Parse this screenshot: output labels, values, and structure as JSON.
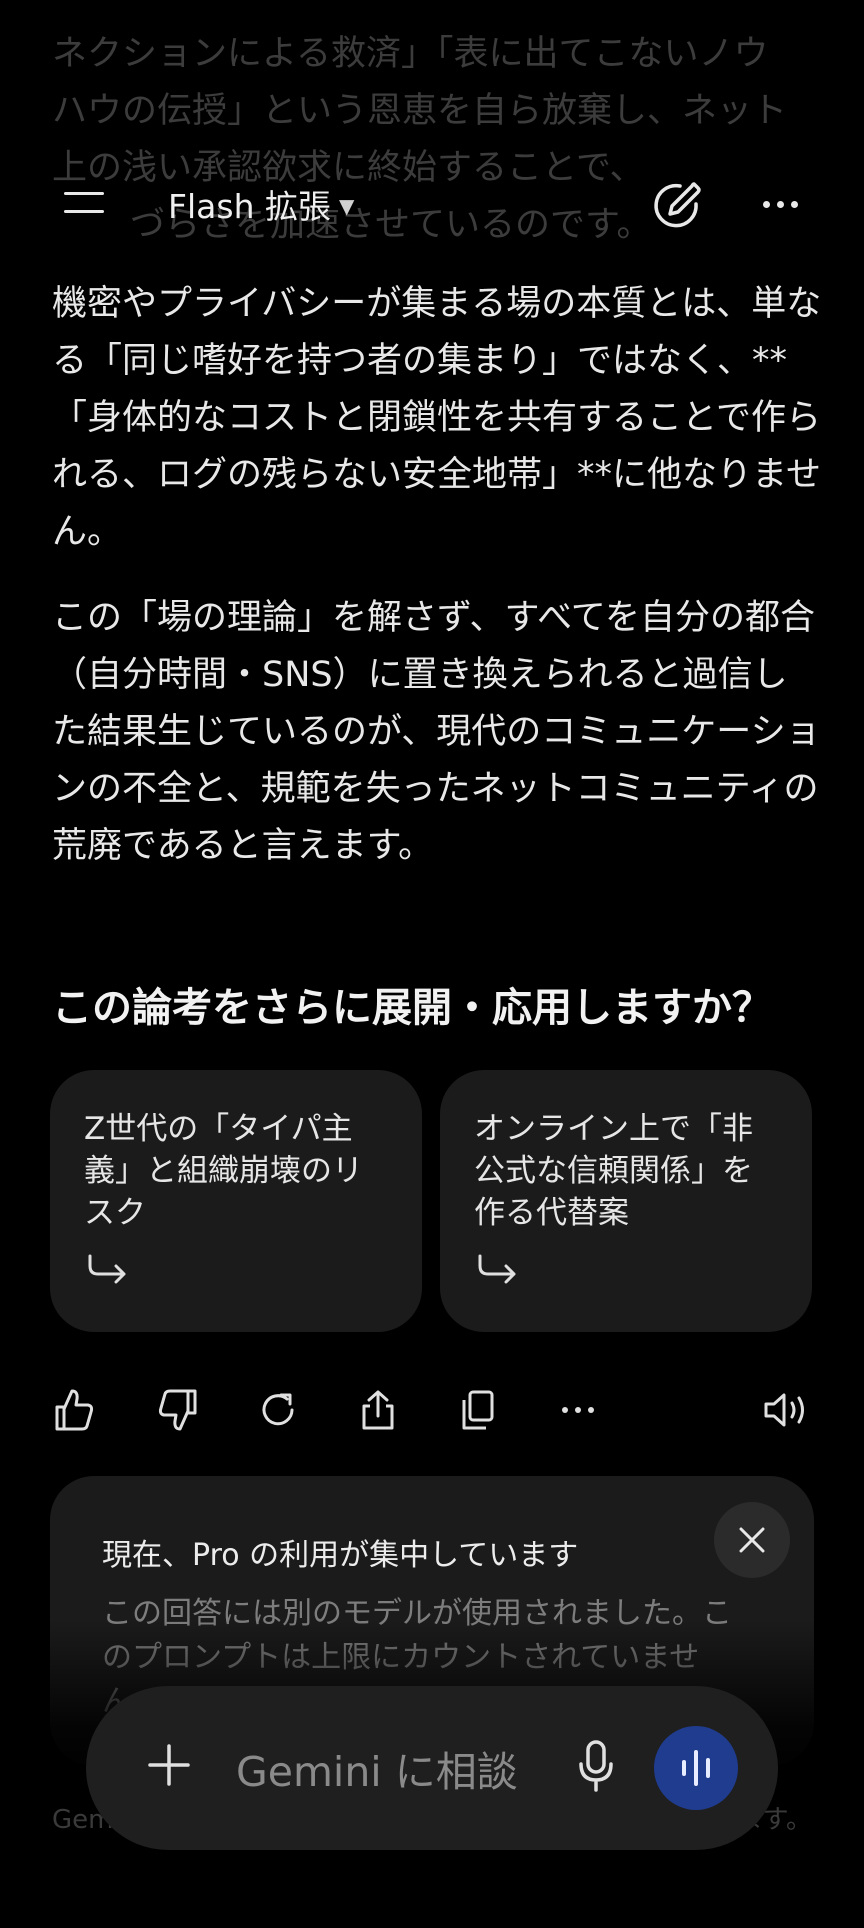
{
  "header": {
    "model_label": "Flash 拡張"
  },
  "content": {
    "faded_lines": [
      "ネクションによる救済」「表に出てこないノウ",
      "ハウの伝授」という恩恵を自ら放棄し、ネット",
      "上の浅い承認欲求に終始することで、",
      "づらさを加速させているのです。"
    ],
    "paragraph1": "機密やプライバシーが集まる場の本質とは、単なる「同じ嗜好を持つ者の集まり」ではなく、**「身体的なコストと閉鎖性を共有することで作られる、ログの残らない安全地帯」**に他なりません。",
    "paragraph2": "この「場の理論」を解さず、すべてを自分の都合（自分時間・SNS）に置き換えられると過信した結果生じているのが、現代のコミュニケーションの不全と、規範を失ったネットコミュニティの荒廃であると言えます。",
    "followup_heading": "この論考をさらに展開・応用しますか？",
    "suggestions": [
      {
        "text": "Z世代の「タイパ主義」と組織崩壊のリスク"
      },
      {
        "text": "オンライン上で「非公式な信頼関係」を作る代替案"
      }
    ]
  },
  "actions": {
    "icons": [
      "thumbs-up-icon",
      "thumbs-down-icon",
      "regenerate-icon",
      "share-icon",
      "copy-icon",
      "more-icon",
      "speaker-icon"
    ]
  },
  "notice": {
    "title": "現在、Pro の利用が集中しています",
    "body": "この回答には別のモデルが使用されました。このプロンプトは上限にカウントされていません。"
  },
  "composer": {
    "placeholder": "Gemini に相談"
  },
  "footer": {
    "disclaimer_start": "Gem",
    "disclaimer_end": "ます。"
  },
  "colors": {
    "background": "#000000",
    "card": "#1b1b1b",
    "voice_button": "#203c8f"
  }
}
